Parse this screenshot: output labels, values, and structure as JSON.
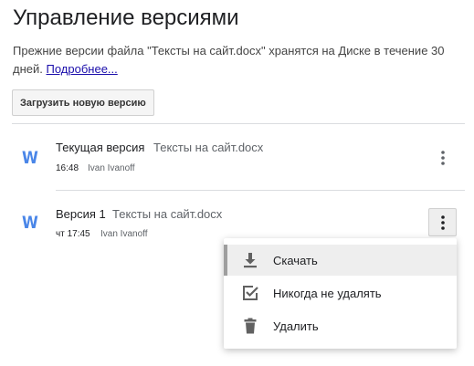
{
  "page": {
    "title": "Управление версиями",
    "description": "Прежние версии файла \"Тексты на сайт.docx\" хранятся на Диске в течение 30 дней.",
    "more_link": "Подробнее...",
    "upload_button": "Загрузить новую версию"
  },
  "versions": [
    {
      "label": "Текущая версия",
      "file_name": "Тексты на сайт.docx",
      "time": "16:48",
      "user": "Ivan Ivanoff",
      "icon_letter": "W"
    },
    {
      "label": "Версия 1",
      "file_name": "Тексты на сайт.docx",
      "time": "чт 17:45",
      "user": "Ivan Ivanoff",
      "icon_letter": "W"
    }
  ],
  "menu": {
    "items": [
      {
        "label": "Скачать",
        "icon": "download-icon"
      },
      {
        "label": "Никогда не удалять",
        "icon": "checkbox-checked-icon"
      },
      {
        "label": "Удалить",
        "icon": "trash-icon"
      }
    ]
  },
  "colors": {
    "word_icon": "#4a86e8",
    "link": "#1a0dab",
    "menu_highlight": "#eeeeee"
  }
}
